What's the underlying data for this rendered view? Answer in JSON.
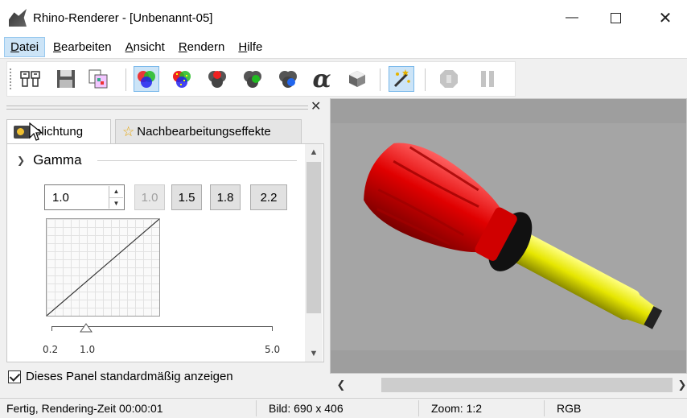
{
  "window": {
    "title": "Rhino-Renderer - [Unbenannt-05]"
  },
  "menu": [
    {
      "label": "Datei",
      "accel": "D",
      "rest": "atei"
    },
    {
      "label": "Bearbeiten",
      "accel": "B",
      "rest": "earbeiten"
    },
    {
      "label": "Ansicht",
      "accel": "A",
      "rest": "nsicht"
    },
    {
      "label": "Rendern",
      "accel": "R",
      "rest": "endern"
    },
    {
      "label": "Hilfe",
      "accel": "H",
      "rest": "ilfe"
    }
  ],
  "panel": {
    "tabs": [
      {
        "label": "Belichtung",
        "visible_text": "elichtung",
        "active": true
      },
      {
        "label": "Nachbearbeitungseffekte",
        "active": false
      }
    ],
    "gamma": {
      "title": "Gamma",
      "value": "1.0",
      "presets": [
        "1.0",
        "1.5",
        "1.8",
        "2.2"
      ],
      "slider_min_label": "0.2",
      "slider_current_label": "1.0",
      "slider_max_label": "5.0",
      "slider_value": 1.0,
      "slider_min": 0.2,
      "slider_max": 5.0
    },
    "show_by_default_label": "Dieses Panel standardmäßig anzeigen",
    "show_by_default_checked": true
  },
  "status": {
    "message": "Fertig, Rendering-Zeit 00:00:01",
    "image_size": "Bild: 690 x 406",
    "zoom": "Zoom: 1:2",
    "mode": "RGB"
  },
  "toolbar": {
    "icons": [
      "clone-icon",
      "save-icon",
      "copy-icon",
      "rgb-channels-icon",
      "rgb-noise-icon",
      "red-channel-icon",
      "green-channel-icon",
      "blue-channel-icon",
      "alpha-channel-icon",
      "object-icon",
      "magic-wand-icon",
      "stop-icon",
      "pause-icon"
    ],
    "alpha_glyph": "α"
  },
  "colors": {
    "accent": "#cce4f7",
    "handle": "#e00000",
    "shaft": "#e6e600"
  }
}
